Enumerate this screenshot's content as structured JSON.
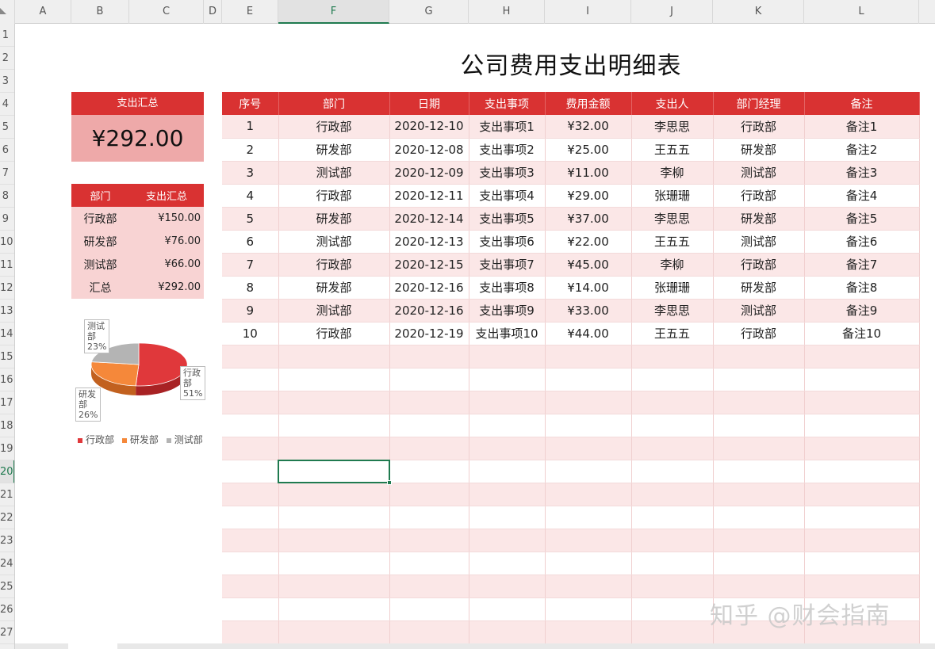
{
  "sheet": {
    "columns": [
      "A",
      "B",
      "C",
      "D",
      "E",
      "F",
      "G",
      "H",
      "I",
      "J",
      "K",
      "L"
    ],
    "active_column": "F",
    "rows": [
      "1",
      "2",
      "3",
      "4",
      "5",
      "6",
      "7",
      "8",
      "9",
      "10",
      "11",
      "12",
      "13",
      "14",
      "15",
      "16",
      "17",
      "18",
      "19",
      "20",
      "21",
      "22",
      "23",
      "24",
      "25",
      "26",
      "27"
    ],
    "active_row": "20"
  },
  "title": "公司费用支出明细表",
  "summary_card": {
    "header": "支出汇总",
    "value": "¥292.00"
  },
  "dept_summary": {
    "headers": [
      "部门",
      "支出汇总"
    ],
    "rows": [
      [
        "行政部",
        "¥150.00"
      ],
      [
        "研发部",
        "¥76.00"
      ],
      [
        "测试部",
        "¥66.00"
      ],
      [
        "汇总",
        "¥292.00"
      ]
    ]
  },
  "chart_data": {
    "type": "pie",
    "categories": [
      "行政部",
      "研发部",
      "测试部"
    ],
    "values": [
      51,
      26,
      23
    ],
    "colors": [
      "#e0383b",
      "#f5883a",
      "#b4b4b4"
    ],
    "labels": [
      {
        "name": "行政部",
        "text": "行政\n部\n51%"
      },
      {
        "name": "研发部",
        "text": "研发\n部\n26%"
      },
      {
        "name": "测试部",
        "text": "测试\n部\n23%"
      }
    ],
    "legend": [
      "行政部",
      "研发部",
      "测试部"
    ],
    "legend_position": "bottom"
  },
  "main_table": {
    "headers": [
      "序号",
      "部门",
      "日期",
      "支出事项",
      "费用金额",
      "支出人",
      "部门经理",
      "备注"
    ],
    "rows": [
      [
        "1",
        "行政部",
        "2020-12-10",
        "支出事项1",
        "¥32.00",
        "李思思",
        "行政部",
        "备注1"
      ],
      [
        "2",
        "研发部",
        "2020-12-08",
        "支出事项2",
        "¥25.00",
        "王五五",
        "研发部",
        "备注2"
      ],
      [
        "3",
        "测试部",
        "2020-12-09",
        "支出事项3",
        "¥11.00",
        "李柳",
        "测试部",
        "备注3"
      ],
      [
        "4",
        "行政部",
        "2020-12-11",
        "支出事项4",
        "¥29.00",
        "张珊珊",
        "行政部",
        "备注4"
      ],
      [
        "5",
        "研发部",
        "2020-12-14",
        "支出事项5",
        "¥37.00",
        "李思思",
        "研发部",
        "备注5"
      ],
      [
        "6",
        "测试部",
        "2020-12-13",
        "支出事项6",
        "¥22.00",
        "王五五",
        "测试部",
        "备注6"
      ],
      [
        "7",
        "行政部",
        "2020-12-15",
        "支出事项7",
        "¥45.00",
        "李柳",
        "行政部",
        "备注7"
      ],
      [
        "8",
        "研发部",
        "2020-12-16",
        "支出事项8",
        "¥14.00",
        "张珊珊",
        "研发部",
        "备注8"
      ],
      [
        "9",
        "测试部",
        "2020-12-16",
        "支出事项9",
        "¥33.00",
        "李思思",
        "测试部",
        "备注9"
      ],
      [
        "10",
        "行政部",
        "2020-12-19",
        "支出事项10",
        "¥44.00",
        "王五五",
        "行政部",
        "备注10"
      ]
    ],
    "empty_rows": 13
  },
  "watermark": "知乎 @财会指南",
  "colors": {
    "header_red": "#d93232",
    "band_pink": "#fbe7e7",
    "select_green": "#1f7a4f"
  }
}
